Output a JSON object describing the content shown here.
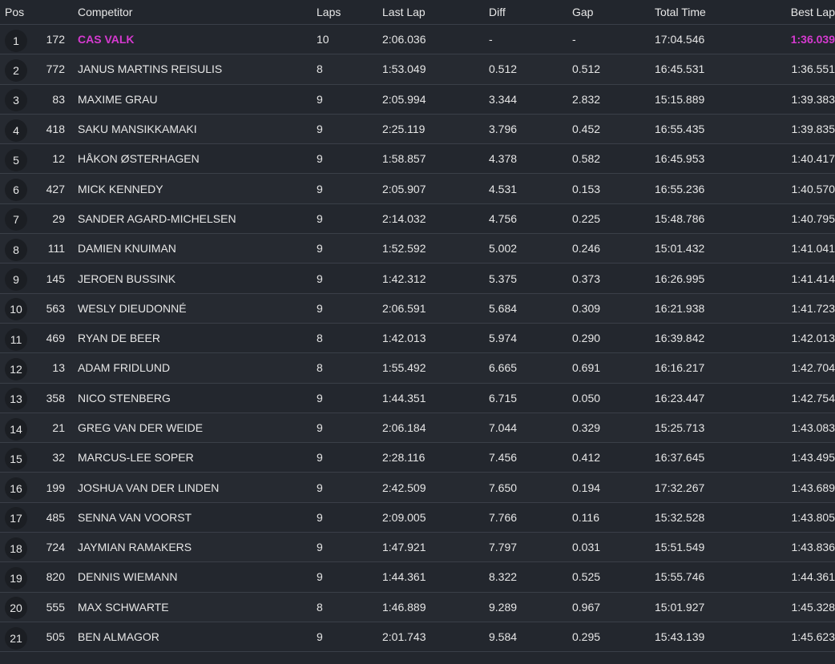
{
  "colors": {
    "background": "#23272e",
    "highlight": "#d63ad0"
  },
  "header": {
    "pos": "Pos",
    "competitor": "Competitor",
    "laps": "Laps",
    "last_lap": "Last Lap",
    "diff": "Diff",
    "gap": "Gap",
    "total_time": "Total Time",
    "best_lap": "Best Lap"
  },
  "rows": [
    {
      "pos": "1",
      "num": "172",
      "name": "CAS VALK",
      "laps": "10",
      "last": "2:06.036",
      "diff": "-",
      "gap": "-",
      "total": "17:04.546",
      "best": "1:36.039"
    },
    {
      "pos": "2",
      "num": "772",
      "name": "JANUS MARTINS REISULIS",
      "laps": "8",
      "last": "1:53.049",
      "diff": "0.512",
      "gap": "0.512",
      "total": "16:45.531",
      "best": "1:36.551"
    },
    {
      "pos": "3",
      "num": "83",
      "name": "MAXIME GRAU",
      "laps": "9",
      "last": "2:05.994",
      "diff": "3.344",
      "gap": "2.832",
      "total": "15:15.889",
      "best": "1:39.383"
    },
    {
      "pos": "4",
      "num": "418",
      "name": "SAKU MANSIKKAMAKI",
      "laps": "9",
      "last": "2:25.119",
      "diff": "3.796",
      "gap": "0.452",
      "total": "16:55.435",
      "best": "1:39.835"
    },
    {
      "pos": "5",
      "num": "12",
      "name": "HÅKON ØSTERHAGEN",
      "laps": "9",
      "last": "1:58.857",
      "diff": "4.378",
      "gap": "0.582",
      "total": "16:45.953",
      "best": "1:40.417"
    },
    {
      "pos": "6",
      "num": "427",
      "name": "MICK KENNEDY",
      "laps": "9",
      "last": "2:05.907",
      "diff": "4.531",
      "gap": "0.153",
      "total": "16:55.236",
      "best": "1:40.570"
    },
    {
      "pos": "7",
      "num": "29",
      "name": "SANDER AGARD-MICHELSEN",
      "laps": "9",
      "last": "2:14.032",
      "diff": "4.756",
      "gap": "0.225",
      "total": "15:48.786",
      "best": "1:40.795"
    },
    {
      "pos": "8",
      "num": "111",
      "name": "DAMIEN KNUIMAN",
      "laps": "9",
      "last": "1:52.592",
      "diff": "5.002",
      "gap": "0.246",
      "total": "15:01.432",
      "best": "1:41.041"
    },
    {
      "pos": "9",
      "num": "145",
      "name": "JEROEN BUSSINK",
      "laps": "9",
      "last": "1:42.312",
      "diff": "5.375",
      "gap": "0.373",
      "total": "16:26.995",
      "best": "1:41.414"
    },
    {
      "pos": "10",
      "num": "563",
      "name": "WESLY DIEUDONNÉ",
      "laps": "9",
      "last": "2:06.591",
      "diff": "5.684",
      "gap": "0.309",
      "total": "16:21.938",
      "best": "1:41.723"
    },
    {
      "pos": "11",
      "num": "469",
      "name": "RYAN DE BEER",
      "laps": "8",
      "last": "1:42.013",
      "diff": "5.974",
      "gap": "0.290",
      "total": "16:39.842",
      "best": "1:42.013"
    },
    {
      "pos": "12",
      "num": "13",
      "name": "ADAM FRIDLUND",
      "laps": "8",
      "last": "1:55.492",
      "diff": "6.665",
      "gap": "0.691",
      "total": "16:16.217",
      "best": "1:42.704"
    },
    {
      "pos": "13",
      "num": "358",
      "name": "NICO STENBERG",
      "laps": "9",
      "last": "1:44.351",
      "diff": "6.715",
      "gap": "0.050",
      "total": "16:23.447",
      "best": "1:42.754"
    },
    {
      "pos": "14",
      "num": "21",
      "name": "GREG VAN DER WEIDE",
      "laps": "9",
      "last": "2:06.184",
      "diff": "7.044",
      "gap": "0.329",
      "total": "15:25.713",
      "best": "1:43.083"
    },
    {
      "pos": "15",
      "num": "32",
      "name": "MARCUS-LEE SOPER",
      "laps": "9",
      "last": "2:28.116",
      "diff": "7.456",
      "gap": "0.412",
      "total": "16:37.645",
      "best": "1:43.495"
    },
    {
      "pos": "16",
      "num": "199",
      "name": "JOSHUA VAN DER LINDEN",
      "laps": "9",
      "last": "2:42.509",
      "diff": "7.650",
      "gap": "0.194",
      "total": "17:32.267",
      "best": "1:43.689"
    },
    {
      "pos": "17",
      "num": "485",
      "name": "SENNA VAN VOORST",
      "laps": "9",
      "last": "2:09.005",
      "diff": "7.766",
      "gap": "0.116",
      "total": "15:32.528",
      "best": "1:43.805"
    },
    {
      "pos": "18",
      "num": "724",
      "name": "JAYMIAN RAMAKERS",
      "laps": "9",
      "last": "1:47.921",
      "diff": "7.797",
      "gap": "0.031",
      "total": "15:51.549",
      "best": "1:43.836"
    },
    {
      "pos": "19",
      "num": "820",
      "name": "DENNIS WIEMANN",
      "laps": "9",
      "last": "1:44.361",
      "diff": "8.322",
      "gap": "0.525",
      "total": "15:55.746",
      "best": "1:44.361"
    },
    {
      "pos": "20",
      "num": "555",
      "name": "MAX SCHWARTE",
      "laps": "8",
      "last": "1:46.889",
      "diff": "9.289",
      "gap": "0.967",
      "total": "15:01.927",
      "best": "1:45.328"
    },
    {
      "pos": "21",
      "num": "505",
      "name": "BEN ALMAGOR",
      "laps": "9",
      "last": "2:01.743",
      "diff": "9.584",
      "gap": "0.295",
      "total": "15:43.139",
      "best": "1:45.623"
    }
  ]
}
